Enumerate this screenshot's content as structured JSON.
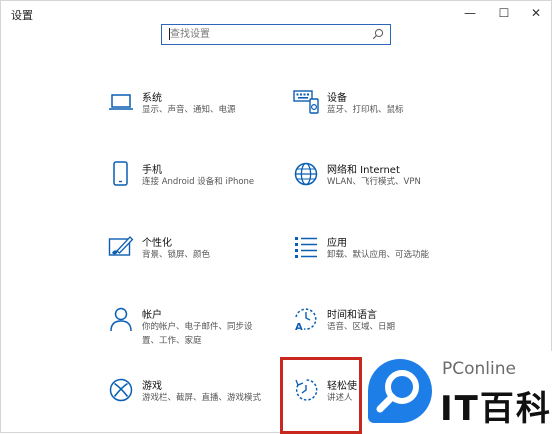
{
  "window": {
    "title": "设置",
    "minimize_glyph": "—",
    "maximize_glyph": "☐",
    "close_glyph": "✕"
  },
  "search": {
    "placeholder": "查找设置",
    "icon": "search-icon"
  },
  "categories": [
    {
      "id": "system",
      "name": "系统",
      "desc": "显示、声音、通知、电源",
      "icon": "laptop-icon"
    },
    {
      "id": "devices",
      "name": "设备",
      "desc": "蓝牙、打印机、鼠标",
      "icon": "keyboard-icon"
    },
    {
      "id": "phone",
      "name": "手机",
      "desc": "连接 Android 设备和 iPhone",
      "icon": "phone-icon"
    },
    {
      "id": "network",
      "name": "网络和 Internet",
      "desc": "WLAN、飞行模式、VPN",
      "icon": "globe-icon"
    },
    {
      "id": "personalization",
      "name": "个性化",
      "desc": "背景、锁屏、颜色",
      "icon": "paint-icon"
    },
    {
      "id": "apps",
      "name": "应用",
      "desc": "卸载、默认应用、可选功能",
      "icon": "apps-list-icon"
    },
    {
      "id": "accounts",
      "name": "帐户",
      "desc_lines": [
        "你的帐户、电子邮件、同步设",
        "置、工作、家庭"
      ],
      "icon": "person-icon"
    },
    {
      "id": "time",
      "name": "时间和语言",
      "desc": "语音、区域、日期",
      "icon": "time-language-icon"
    },
    {
      "id": "gaming",
      "name": "游戏",
      "desc": "游戏栏、截屏、直播、游戏模式",
      "icon": "xbox-icon"
    },
    {
      "id": "ease",
      "name": "轻松使",
      "desc": "讲述人",
      "icon": "ease-of-access-icon"
    }
  ],
  "watermark": {
    "brand": "PConline",
    "logo_text": "IT百科",
    "color": "#1e7ee8"
  },
  "colors": {
    "accent": "#0a5fb4",
    "highlight": "#c8281e"
  }
}
